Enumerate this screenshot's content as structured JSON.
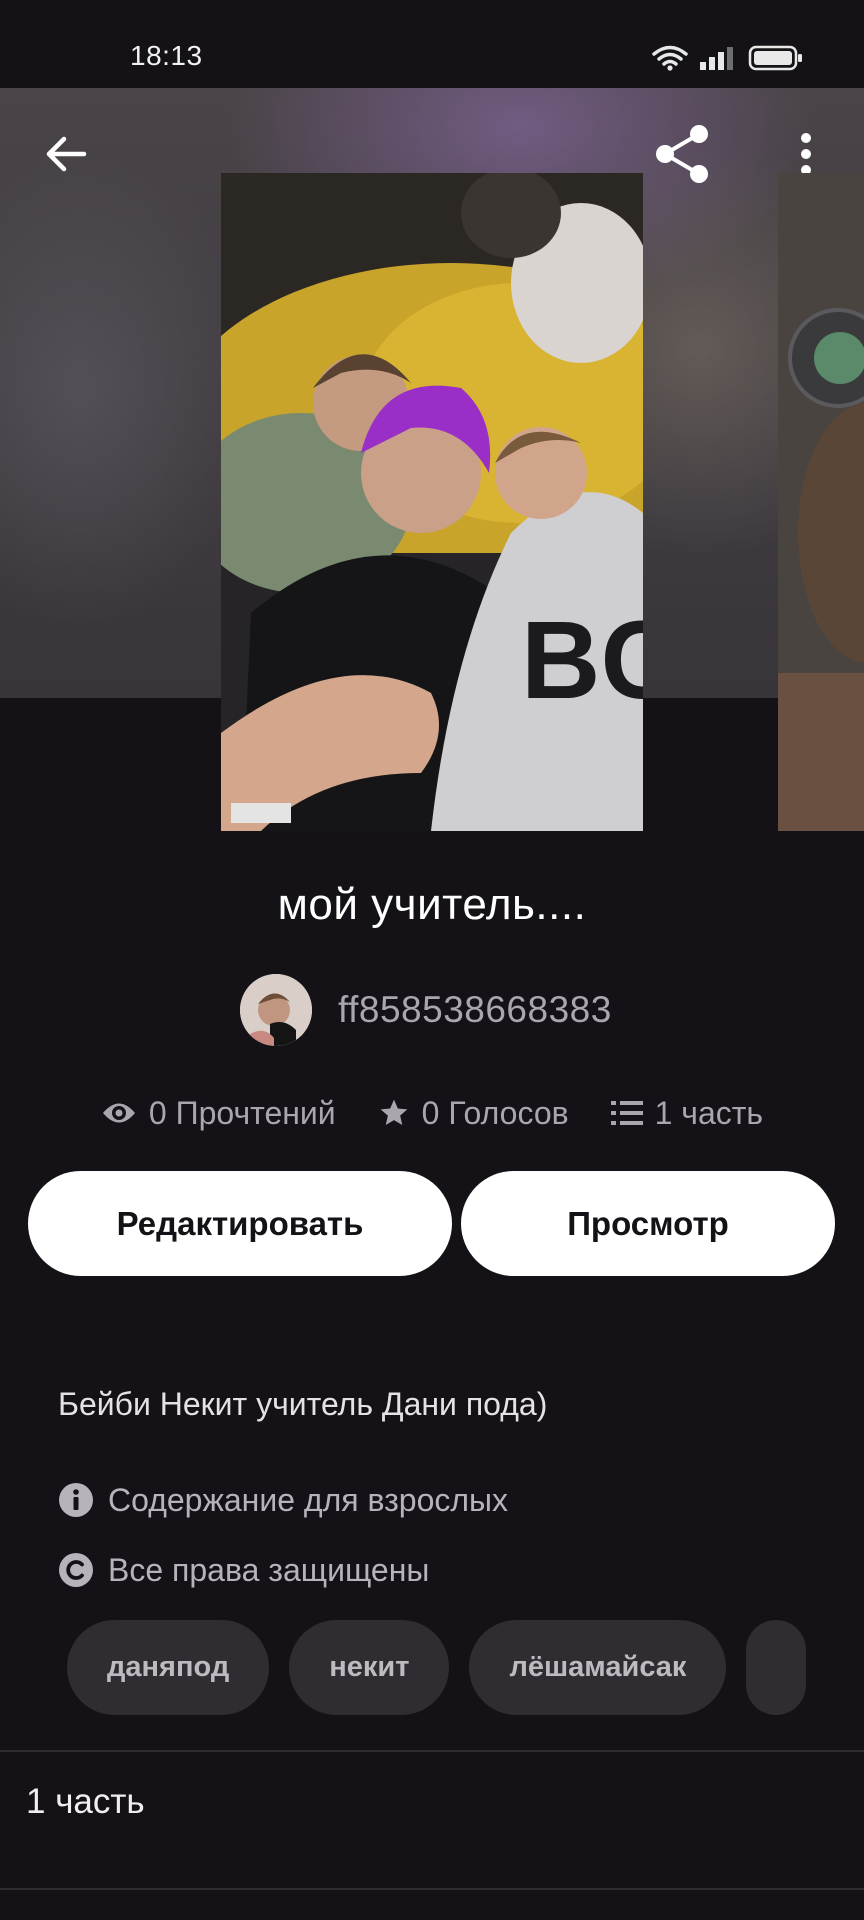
{
  "status_bar": {
    "time": "18:13"
  },
  "story": {
    "title": "мой учитель....",
    "author": "ff858538668383",
    "description": "Бейби Некит учитель Дани пода)"
  },
  "stats": {
    "reads": "0 Прочтений",
    "votes": "0 Голосов",
    "parts": "1 часть"
  },
  "buttons": {
    "edit": "Редактировать",
    "view": "Просмотр"
  },
  "info": {
    "mature": "Содержание для взрослых",
    "rights": "Все права защищены"
  },
  "tags": [
    "даняпод",
    "некит",
    "лёшамайсак"
  ],
  "parts_section": {
    "label": "1 часть"
  },
  "icons": {
    "back": "arrow-left-icon",
    "share": "share-icon",
    "more": "more-vertical-icon",
    "reads": "eye-icon",
    "votes": "star-icon",
    "parts": "list-icon",
    "mature": "info-icon",
    "rights": "copyright-icon"
  }
}
